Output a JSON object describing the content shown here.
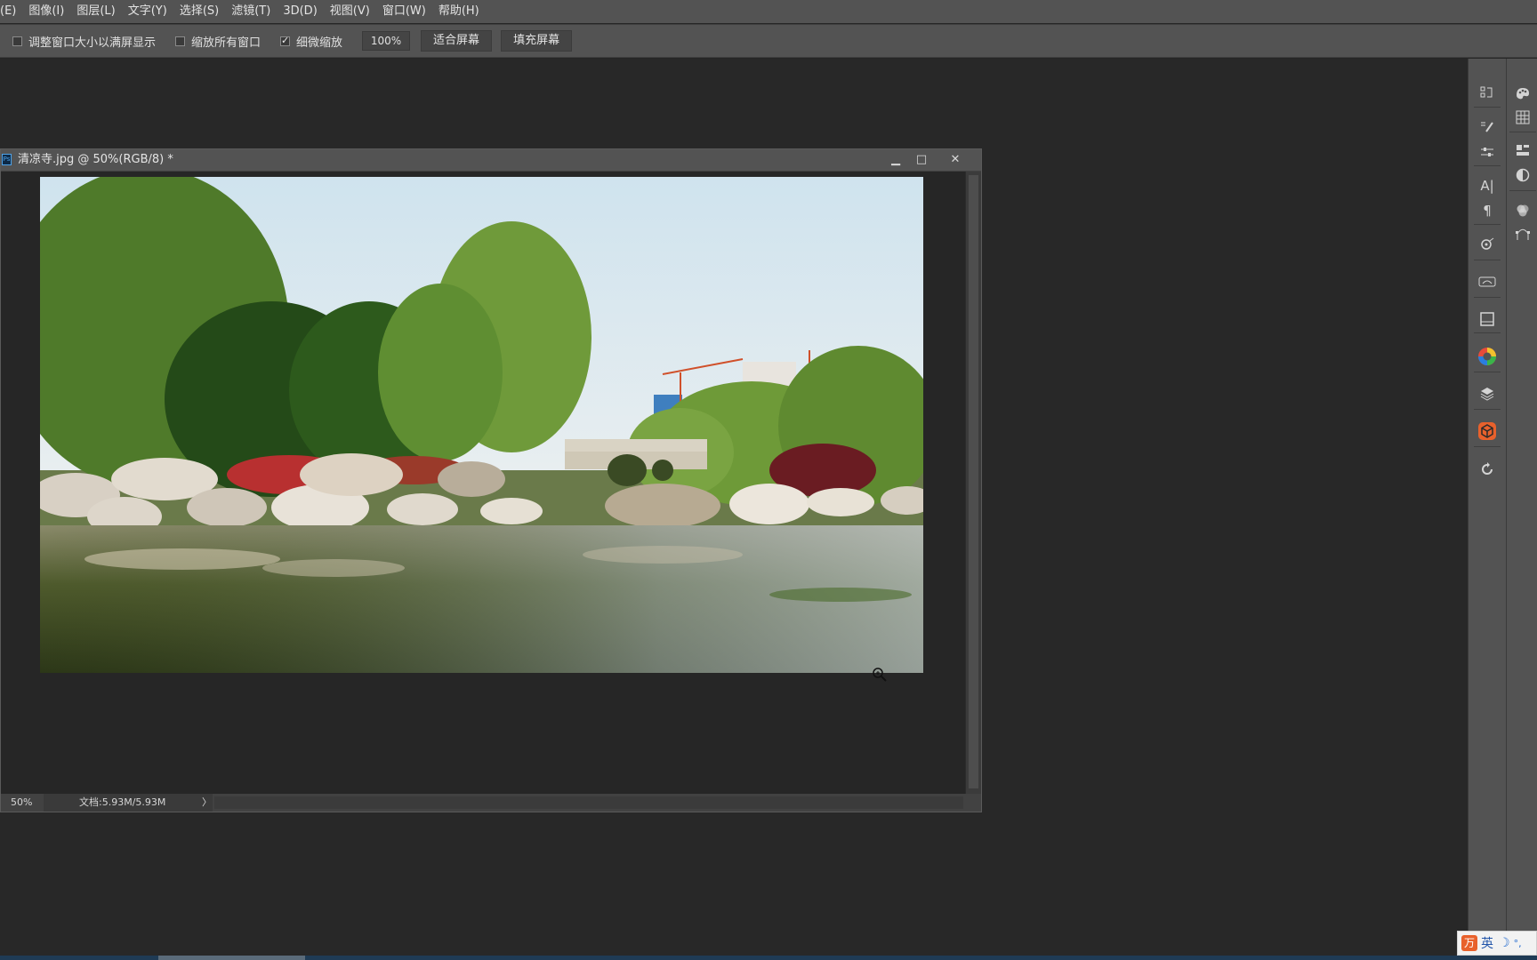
{
  "menu": {
    "items": [
      "(E)",
      "图像(I)",
      "图层(L)",
      "文字(Y)",
      "选择(S)",
      "滤镜(T)",
      "3D(D)",
      "视图(V)",
      "窗口(W)",
      "帮助(H)"
    ]
  },
  "options": {
    "resize_windows": {
      "label": "调整窗口大小以满屏显示",
      "checked": false
    },
    "zoom_all": {
      "label": "缩放所有窗口",
      "checked": false
    },
    "scrubby_zoom": {
      "label": "细微缩放",
      "checked": true
    },
    "zoom_value": "100%",
    "fit_screen_label": "适合屏幕",
    "fill_screen_label": "填充屏幕"
  },
  "document": {
    "title": "清凉寺.jpg @ 50%(RGB/8) *",
    "ps_badge": "Ps",
    "minimize_glyph": "▁",
    "maximize_glyph": "□",
    "close_glyph": "✕",
    "status_zoom": "50%",
    "status_doc": "文档:5.93M/5.93M",
    "status_arrow": "〉"
  },
  "panels": {
    "collapse_glyph": "«",
    "col1_icons": [
      "history-icon",
      "brush-presets-icon",
      "brush-settings-icon",
      "character-icon",
      "paragraph-icon",
      "clone-source-icon",
      "timeline-icon",
      "properties-icon",
      "color-wheel-icon",
      "layers-icon",
      "3d-icon",
      "rotate-icon"
    ],
    "col2_icons": [
      "swatches-icon",
      "grid-icon",
      "libraries-icon",
      "adjustments-icon",
      "channels-icon",
      "paths-icon"
    ],
    "col1_glyphs": {
      "character": "A|",
      "paragraph": "¶"
    }
  },
  "ime": {
    "logo": "万",
    "lang": "英",
    "moon": "☽",
    "extra": "°,"
  },
  "colors": {
    "menubar": "#535353",
    "workspace": "#282828",
    "panel": "#535353",
    "accent_ps": "#4fa3e8"
  }
}
